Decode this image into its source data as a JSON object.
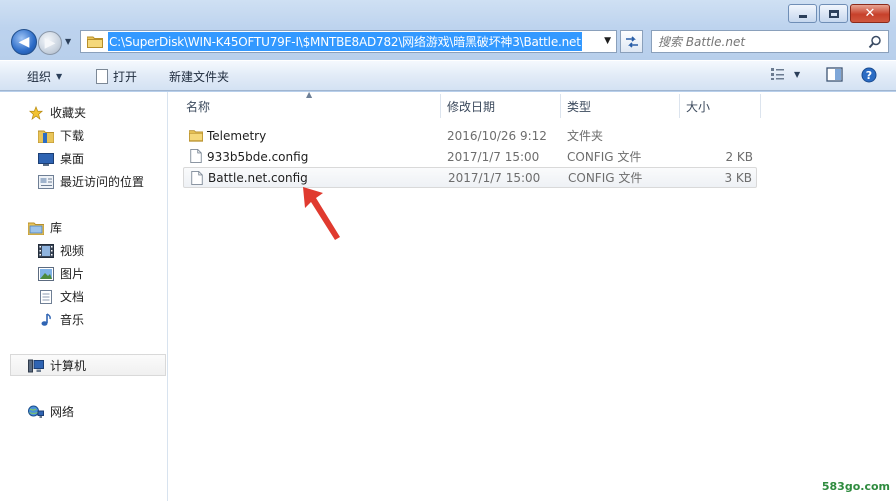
{
  "address_bar": {
    "path": "C:\\SuperDisk\\WIN-K45OFTU79F-I\\$MNTBE8AD782\\网络游戏\\暗黑破坏神3\\Battle.net"
  },
  "search": {
    "placeholder": "搜索 Battle.net"
  },
  "toolbar": {
    "organize_label": "组织",
    "open_label": "打开",
    "new_folder_label": "新建文件夹"
  },
  "nav_pane": {
    "favorites": "收藏夹",
    "favorites_items": [
      "下载",
      "桌面",
      "最近访问的位置"
    ],
    "libraries": "库",
    "libraries_items": [
      "视频",
      "图片",
      "文档",
      "音乐"
    ],
    "computer": "计算机",
    "network": "网络"
  },
  "columns": {
    "name": "名称",
    "date": "修改日期",
    "type": "类型",
    "size": "大小"
  },
  "files": [
    {
      "name": "Telemetry",
      "date": "2016/10/26 9:12",
      "type": "文件夹",
      "size": "",
      "kind": "folder"
    },
    {
      "name": "933b5bde.config",
      "date": "2017/1/7 15:00",
      "type": "CONFIG 文件",
      "size": "2 KB",
      "kind": "file"
    },
    {
      "name": "Battle.net.config",
      "date": "2017/1/7 15:00",
      "type": "CONFIG 文件",
      "size": "3 KB",
      "kind": "file"
    }
  ],
  "watermark": "583go.com",
  "colors": {
    "selection_blue": "#3399ff",
    "annotation_red": "#e03a2f",
    "folder_yellow": "#e9c55a"
  }
}
